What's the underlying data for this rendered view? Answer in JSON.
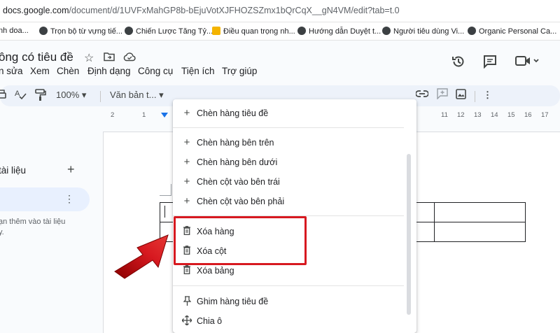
{
  "browser": {
    "url_host": "docs.google.com",
    "url_path": "/document/d/1UVFxMahGP8b-bEjuVotXJFHOZSZmx1bQrCqX__gN4VM/edit?tab=t.0",
    "bookmarks": [
      {
        "label": "nh doa..."
      },
      {
        "label": "Trọn bộ từ vựng tiế..."
      },
      {
        "label": "Chiến Lược Tăng Tỷ..."
      },
      {
        "label": "Điều quan trọng nh..."
      },
      {
        "label": "Hướng dẫn Duyệt t..."
      },
      {
        "label": "Người tiêu dùng Vi..."
      },
      {
        "label": "Organic Personal Ca..."
      }
    ]
  },
  "docs": {
    "title": "ông có tiêu đề",
    "menu": [
      "n sửa",
      "Xem",
      "Chèn",
      "Định dạng",
      "Công cụ",
      "Tiện ích",
      "Trợ giúp"
    ],
    "toolbar": {
      "zoom": "100%",
      "style": "Văn bản t..."
    },
    "ruler_labels": [
      "2",
      "1",
      "11",
      "12",
      "13",
      "14",
      "15",
      "16",
      "17"
    ],
    "outline": {
      "heading": "tài liệu",
      "hint_line1": "ạn thêm vào tài liệu",
      "hint_line2": "y."
    }
  },
  "context_menu": {
    "items": [
      {
        "icon": "plus-icon",
        "label": "Chèn hàng tiêu đề"
      },
      {
        "icon": "plus-icon",
        "label": "Chèn hàng bên trên"
      },
      {
        "icon": "plus-icon",
        "label": "Chèn hàng bên dưới"
      },
      {
        "icon": "plus-icon",
        "label": "Chèn cột vào bên trái"
      },
      {
        "icon": "plus-icon",
        "label": "Chèn cột vào bên phải"
      },
      {
        "icon": "trash-icon",
        "label": "Xóa hàng"
      },
      {
        "icon": "trash-icon",
        "label": "Xóa cột"
      },
      {
        "icon": "trash-icon",
        "label": "Xóa bảng"
      },
      {
        "icon": "pin-icon",
        "label": "Ghim hàng tiêu đề"
      },
      {
        "icon": "split-cell-icon",
        "label": "Chia ô"
      }
    ]
  },
  "colors": {
    "highlight": "#d71920",
    "accent": "#1a73e8"
  }
}
